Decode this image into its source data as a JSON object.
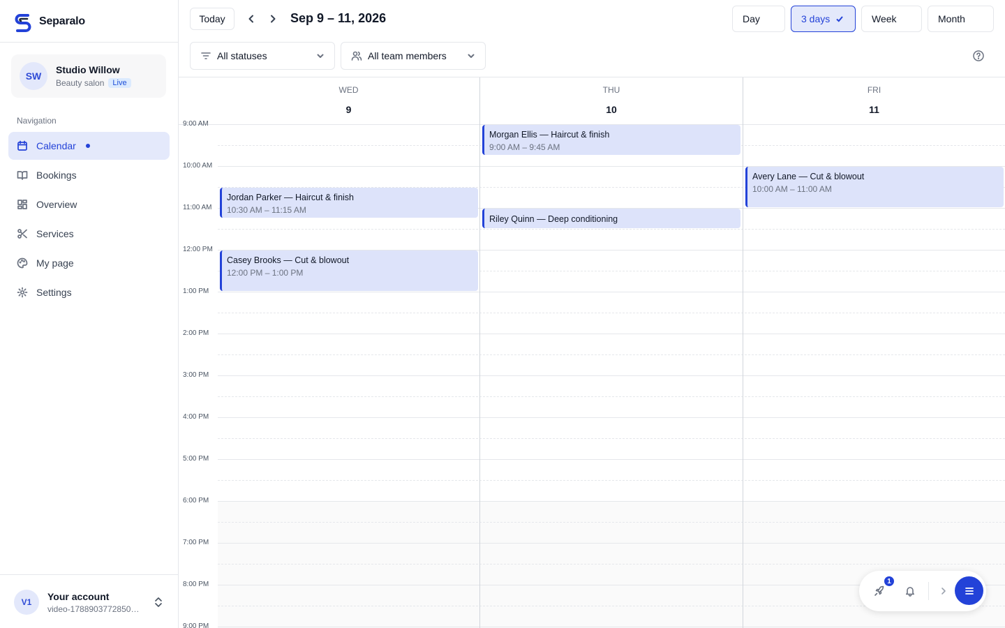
{
  "brand": {
    "name": "Separalo"
  },
  "workspace": {
    "initials": "SW",
    "name": "Studio Willow",
    "type": "Beauty salon",
    "status": "Live"
  },
  "nav": {
    "title": "Navigation",
    "items": [
      {
        "label": "Calendar",
        "icon": "calendar-icon",
        "active": true
      },
      {
        "label": "Bookings",
        "icon": "book-icon"
      },
      {
        "label": "Overview",
        "icon": "grid-icon"
      },
      {
        "label": "Services",
        "icon": "scissors-icon"
      },
      {
        "label": "My page",
        "icon": "palette-icon"
      },
      {
        "label": "Settings",
        "icon": "gear-icon"
      }
    ]
  },
  "account": {
    "initials": "V1",
    "name": "Your account",
    "email": "video-1788903772850@..."
  },
  "toolbar": {
    "today_label": "Today",
    "date_range": "Sep 9 – 11, 2026",
    "views": [
      "Day",
      "3 days",
      "Week",
      "Month"
    ],
    "selected_view": "3 days"
  },
  "filters": {
    "status": "All statuses",
    "team": "All team members"
  },
  "calendar": {
    "days": [
      {
        "dow": "WED",
        "num": "9"
      },
      {
        "dow": "THU",
        "num": "10"
      },
      {
        "dow": "FRI",
        "num": "11"
      }
    ],
    "time_labels": [
      "9:00 AM",
      "10:00 AM",
      "11:00 AM",
      "12:00 PM",
      "1:00 PM",
      "2:00 PM",
      "3:00 PM",
      "4:00 PM",
      "5:00 PM",
      "6:00 PM",
      "7:00 PM",
      "8:00 PM",
      "9:00 PM"
    ],
    "events": [
      {
        "day": 1,
        "title": "Morgan Ellis — Haircut & finish",
        "time": "9:00 AM – 9:45 AM",
        "start": 9.0,
        "end": 9.75
      },
      {
        "day": 0,
        "title": "Jordan Parker — Haircut & finish",
        "time": "10:30 AM – 11:15 AM",
        "start": 10.5,
        "end": 11.25
      },
      {
        "day": 2,
        "title": "Avery Lane — Cut & blowout",
        "time": "10:00 AM – 11:00 AM",
        "start": 10.0,
        "end": 11.0
      },
      {
        "day": 1,
        "title": "Riley Quinn — Deep conditioning",
        "time": "",
        "start": 11.0,
        "end": 11.5
      },
      {
        "day": 0,
        "title": "Casey Brooks — Cut & blowout",
        "time": "12:00 PM – 1:00 PM",
        "start": 12.0,
        "end": 13.0
      }
    ]
  },
  "floating_bar": {
    "notification_count": "1"
  },
  "colors": {
    "accent": "#2342d8",
    "accent_soft": "#e4e9fb",
    "event_bg": "#dde3fa"
  }
}
